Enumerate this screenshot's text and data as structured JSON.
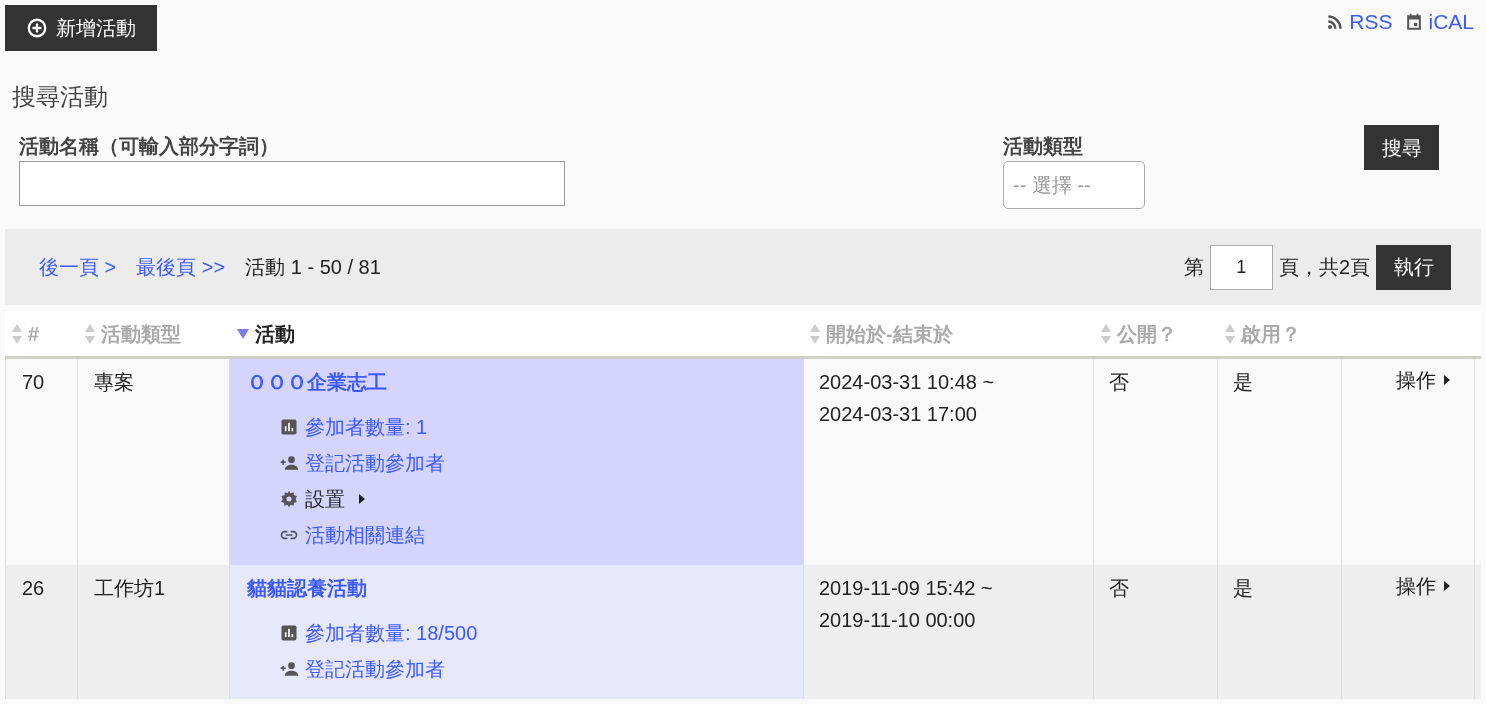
{
  "toolbar": {
    "add_button": "新增活動",
    "feeds": [
      {
        "kind": "rss",
        "label": "RSS"
      },
      {
        "kind": "calendar",
        "label": "iCAL"
      }
    ]
  },
  "search": {
    "title": "搜尋活動",
    "name_label": "活動名稱（可輸入部分字詞）",
    "type_label": "活動類型",
    "type_placeholder": "-- 選擇 --",
    "button": "搜尋"
  },
  "pagination": {
    "next": "後一頁 >",
    "last": "最後頁 >>",
    "range": "活動 1 - 50 / 81",
    "page_prefix": "第",
    "page_value": "1",
    "page_suffix": "頁，共2頁",
    "go_button": "執行"
  },
  "table": {
    "columns": [
      {
        "label": "#",
        "sorted": false
      },
      {
        "label": "活動類型",
        "sorted": false
      },
      {
        "label": "活動",
        "sorted": true
      },
      {
        "label": "開始於-結束於",
        "sorted": false
      },
      {
        "label": "公開？",
        "sorted": false
      },
      {
        "label": "啟用？",
        "sorted": false
      }
    ],
    "rows": [
      {
        "id": "70",
        "type": "專案",
        "title": "ＯＯＯ企業志工",
        "highlighted": true,
        "links": [
          {
            "kind": "stats",
            "label": "參加者數量: 1"
          },
          {
            "kind": "register",
            "label": "登記活動參加者"
          },
          {
            "kind": "settings",
            "label": "設置"
          },
          {
            "kind": "link",
            "label": "活動相關連結"
          }
        ],
        "start": "2024-03-31 10:48 ~",
        "end": "2024-03-31 17:00",
        "public": "否",
        "enabled": "是",
        "action": "操作"
      },
      {
        "id": "26",
        "type": "工作坊1",
        "title": "貓貓認養活動",
        "highlighted": false,
        "links": [
          {
            "kind": "stats",
            "label": "參加者數量: 18/500"
          },
          {
            "kind": "register",
            "label": "登記活動參加者"
          }
        ],
        "start": "2019-11-09 15:42 ~",
        "end": "2019-11-10 00:00",
        "public": "否",
        "enabled": "是",
        "action": "操作"
      }
    ]
  }
}
